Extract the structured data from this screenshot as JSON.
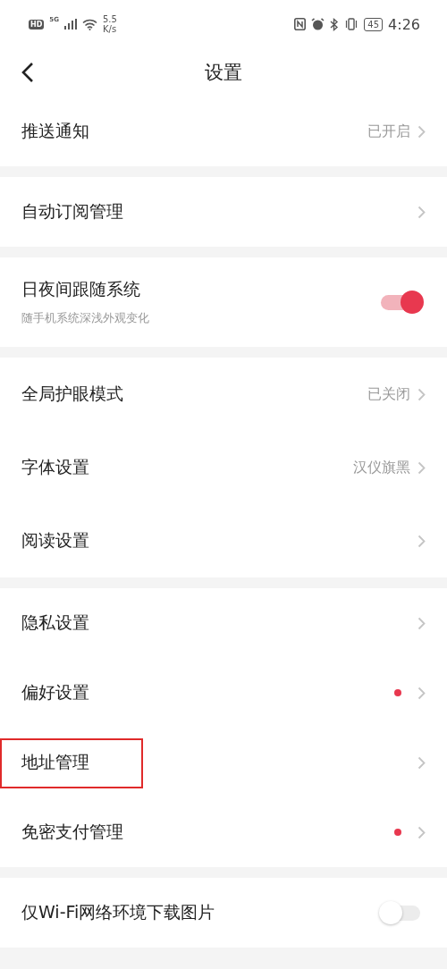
{
  "status_bar": {
    "hd": "HD",
    "network": "5G",
    "speed": "5.5",
    "speed_unit": "K/s",
    "battery": "45",
    "time": "4:26"
  },
  "header": {
    "title": "设置"
  },
  "groups": [
    {
      "items": [
        {
          "kind": "link",
          "label": "推送通知",
          "value": "已开启",
          "dot": false,
          "highlighted": false
        }
      ]
    },
    {
      "items": [
        {
          "kind": "link",
          "label": "自动订阅管理",
          "dot": false,
          "highlighted": false
        }
      ]
    },
    {
      "items": [
        {
          "kind": "toggle",
          "label": "日夜间跟随系统",
          "subtitle": "随手机系统深浅外观变化",
          "on": true
        }
      ]
    },
    {
      "items": [
        {
          "kind": "link",
          "label": "全局护眼模式",
          "value": "已关闭",
          "dot": false,
          "highlighted": false
        },
        {
          "kind": "link",
          "label": "字体设置",
          "value": "汉仪旗黑",
          "dot": false,
          "highlighted": false
        },
        {
          "kind": "link",
          "label": "阅读设置",
          "dot": false,
          "highlighted": false
        }
      ]
    },
    {
      "items": [
        {
          "kind": "link",
          "label": "隐私设置",
          "dot": false,
          "highlighted": false
        },
        {
          "kind": "link",
          "label": "偏好设置",
          "dot": true,
          "highlighted": false
        },
        {
          "kind": "link",
          "label": "地址管理",
          "dot": false,
          "highlighted": true
        },
        {
          "kind": "link",
          "label": "免密支付管理",
          "dot": true,
          "highlighted": false
        }
      ]
    },
    {
      "items": [
        {
          "kind": "toggle",
          "label": "仅Wi-Fi网络环境下载图片",
          "on": false
        }
      ]
    }
  ]
}
